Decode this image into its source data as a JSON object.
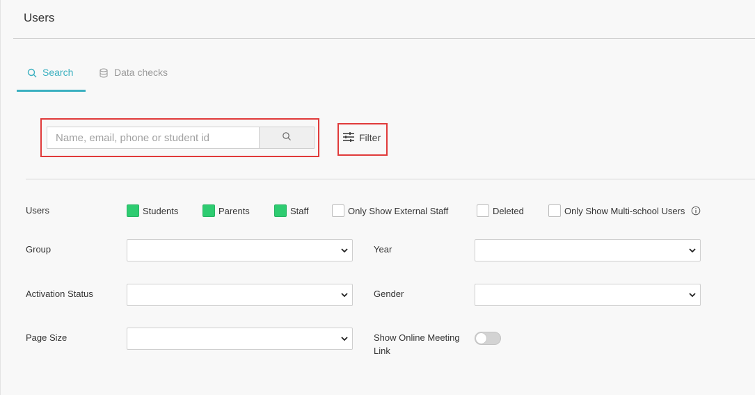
{
  "header": {
    "title": "Users"
  },
  "tabs": [
    {
      "label": "Search",
      "icon": "search-icon",
      "active": true
    },
    {
      "label": "Data checks",
      "icon": "database-icon",
      "active": false
    }
  ],
  "search": {
    "placeholder": "Name, email, phone or student id",
    "value": "",
    "button_icon": "search-icon"
  },
  "filter": {
    "label": "Filter",
    "icon": "sliders-icon"
  },
  "form": {
    "users_label": "Users",
    "user_types": [
      {
        "label": "Students",
        "checked": true
      },
      {
        "label": "Parents",
        "checked": true
      },
      {
        "label": "Staff",
        "checked": true
      },
      {
        "label": "Only Show External Staff",
        "checked": false
      },
      {
        "label": "Deleted",
        "checked": false
      },
      {
        "label": "Only Show Multi-school Users",
        "checked": false
      }
    ],
    "group_label": "Group",
    "group_value": "",
    "year_label": "Year",
    "year_value": "",
    "activation_label": "Activation Status",
    "activation_value": "",
    "gender_label": "Gender",
    "gender_value": "",
    "page_size_label": "Page Size",
    "page_size_value": "",
    "online_meeting_label_1": "Show Online Meeting",
    "online_meeting_label_2": "Link",
    "online_meeting_on": false
  },
  "colors": {
    "accent": "#3bb0c0",
    "checked": "#2ecc71",
    "highlight": "#e03a3a"
  }
}
